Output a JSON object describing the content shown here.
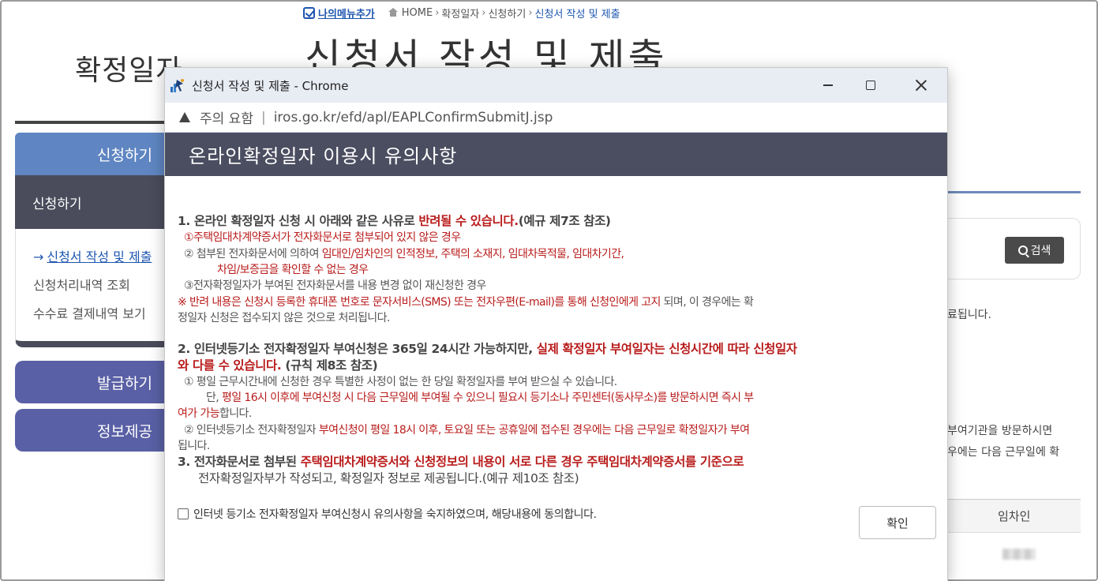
{
  "background": {
    "my_menu_label": "나의메뉴추가",
    "breadcrumb": [
      "HOME",
      "확정일자",
      "신청하기",
      "신청서 작성 및 제출"
    ],
    "breadcrumb_sep": "›",
    "left_title": "확정일자",
    "main_title": "신청서 작성 및 제출",
    "sidebar": {
      "head": "신청하기",
      "sub": "신청하기",
      "items": [
        "신청서 작성 및 제출",
        "신청처리내역 조회",
        "수수료 결제내역 보기"
      ],
      "btn_issue": "발급하기",
      "btn_info": "정보제공"
    },
    "search_button": "검색",
    "right_texts": [
      "료됩니다.",
      "부여기관을 방문하시면",
      "우에는 다음 근무일에 확"
    ],
    "table_header": "임차인"
  },
  "popup": {
    "window_title": "신청서 작성 및 제출 - Chrome",
    "security_label": "주의 요함",
    "url_sep": "|",
    "url": "iros.go.kr/efd/apl/EAPLConfirmSubmitJ.jsp",
    "heading": "온라인확정일자 이용시 유의사항",
    "s1": {
      "a": "1. 온라인 확정일자 신청 시 아래와 같은 사유로 ",
      "b": "반려될 수 있습니다.",
      "c": "(예규 제7조 참조)"
    },
    "s1_1": "①주택임대차계약증서가 전자화문서로 첨부되어 있지 않은 경우",
    "s1_2": {
      "a": "② 첨부된 전자화문서에 의하여 ",
      "b": "임대인/임차인의 인적정보, 주택의 소재지, 임대차목적물, 임대차기간,"
    },
    "s1_2b": "차임/보증금을 확인할 수 없는 경우",
    "s1_3": "③전자확정일자가 부여된 전자화문서를 내용 변경 없이 재신청한 경우",
    "s1_note": {
      "a": "※ ",
      "b": "반려 내용은 신청시 등록한 휴대폰 번호로 문자서비스(SMS) 또는 전자우편(E-mail)를 통해 신청인에게 고지",
      "c": " 되며, 이 경우에는 확"
    },
    "s1_note2": "정일자 신청은 접수되지 않은 것으로 처리됩니다.",
    "s2": {
      "a": "2. 인터넷등기소 전자확정일자 부여신청은 365일 24시간 가능하지만, ",
      "b": "실제 확정일자 부여일자는 신청시간에 따라 신청일자"
    },
    "s2b": {
      "a": "와 다를 수 있습니다.",
      "b": " (규칙 제8조 참조)"
    },
    "s2_1": "① 평일 근무시간내에 신청한 경우 특별한 사정이 없는 한 당일 확정일자를 부여 받으실 수 있습니다.",
    "s2_1b": {
      "a": "단, ",
      "b": "평일 16시 이후에 부여신청 시 다음 근무일에 부여될 수 있으니 필요시 등기소나 주민센터(동사무소)를 방문하시면 즉시 부"
    },
    "s2_1c": "여가 가능",
    "s2_1c_tail": "합니다.",
    "s2_2": {
      "a": "② 인터넷등기소 전자확정일자 ",
      "b": "부여신청이 평일 18시 이후, 토요일 또는 공휴일에 접수된 경우에는 다음 근무일로 확정일자가 부여"
    },
    "s2_2b": "됩니다.",
    "s3": {
      "a": "3. 전자화문서로 첨부된 ",
      "b": "주택임대차계약증서와 신청정보의 내용이 서로 다른 경우 주택임대차계약증서를 기준으로"
    },
    "s3b": "전자확정일자부가 작성되고, 확정일자 정보로 제공됩니다.(예규 제10조 참조)",
    "agree_label": "인터넷 등기소 전자확정일자 부여신청시 유의사항을 숙지하였으며, 해당내용에 동의합니다.",
    "confirm_label": "확인"
  }
}
